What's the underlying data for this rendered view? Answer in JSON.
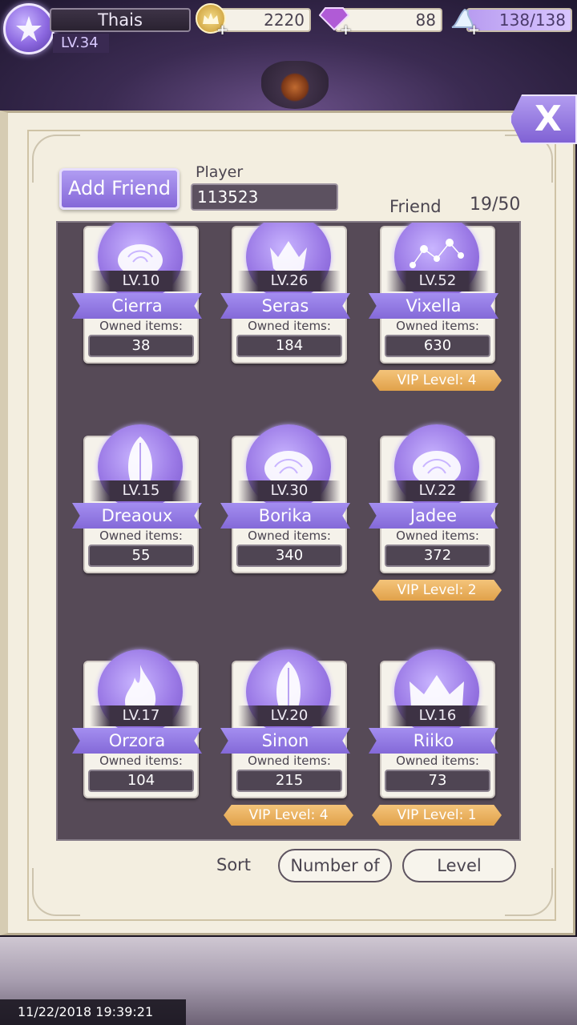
{
  "player": {
    "name": "Thais",
    "level": "LV.34"
  },
  "currencies": {
    "gold": {
      "value": "2220",
      "icon": "crown-coin-icon",
      "color": "#d9b24a"
    },
    "gems": {
      "value": "88",
      "icon": "diamond-icon",
      "color": "#b56bd9"
    },
    "stamina": {
      "value": "138/138",
      "icon": "glass-slipper-icon"
    }
  },
  "close_label": "X",
  "add_friend_label": "Add Friend",
  "player_search": {
    "label": "Player",
    "value": "113523"
  },
  "friend_label": "Friend",
  "friend_count": "19/50",
  "owned_label": "Owned items:",
  "friends": [
    {
      "level": "LV.10",
      "name": "Cierra",
      "owned": "38",
      "icon": "rose-icon"
    },
    {
      "level": "LV.26",
      "name": "Seras",
      "owned": "184",
      "icon": "jester-mask-icon"
    },
    {
      "level": "LV.52",
      "name": "Vixella",
      "owned": "630",
      "icon": "constellation-icon",
      "vip": "VIP Level: 4"
    },
    {
      "level": "LV.15",
      "name": "Dreaoux",
      "owned": "55",
      "icon": "leaf-icon"
    },
    {
      "level": "LV.30",
      "name": "Borika",
      "owned": "340",
      "icon": "rose-icon"
    },
    {
      "level": "LV.22",
      "name": "Jadee",
      "owned": "372",
      "icon": "rose-icon",
      "vip": "VIP Level: 2"
    },
    {
      "level": "LV.17",
      "name": "Orzora",
      "owned": "104",
      "icon": "flame-icon"
    },
    {
      "level": "LV.20",
      "name": "Sinon",
      "owned": "215",
      "icon": "leaf-icon",
      "vip": "VIP Level: 4"
    },
    {
      "level": "LV.16",
      "name": "Riiko",
      "owned": "73",
      "icon": "crown-icon",
      "vip": "VIP Level: 1"
    }
  ],
  "sort": {
    "label": "Sort",
    "option_number": "Number of",
    "option_level": "Level"
  },
  "timestamp": "11/22/2018 19:39:21"
}
